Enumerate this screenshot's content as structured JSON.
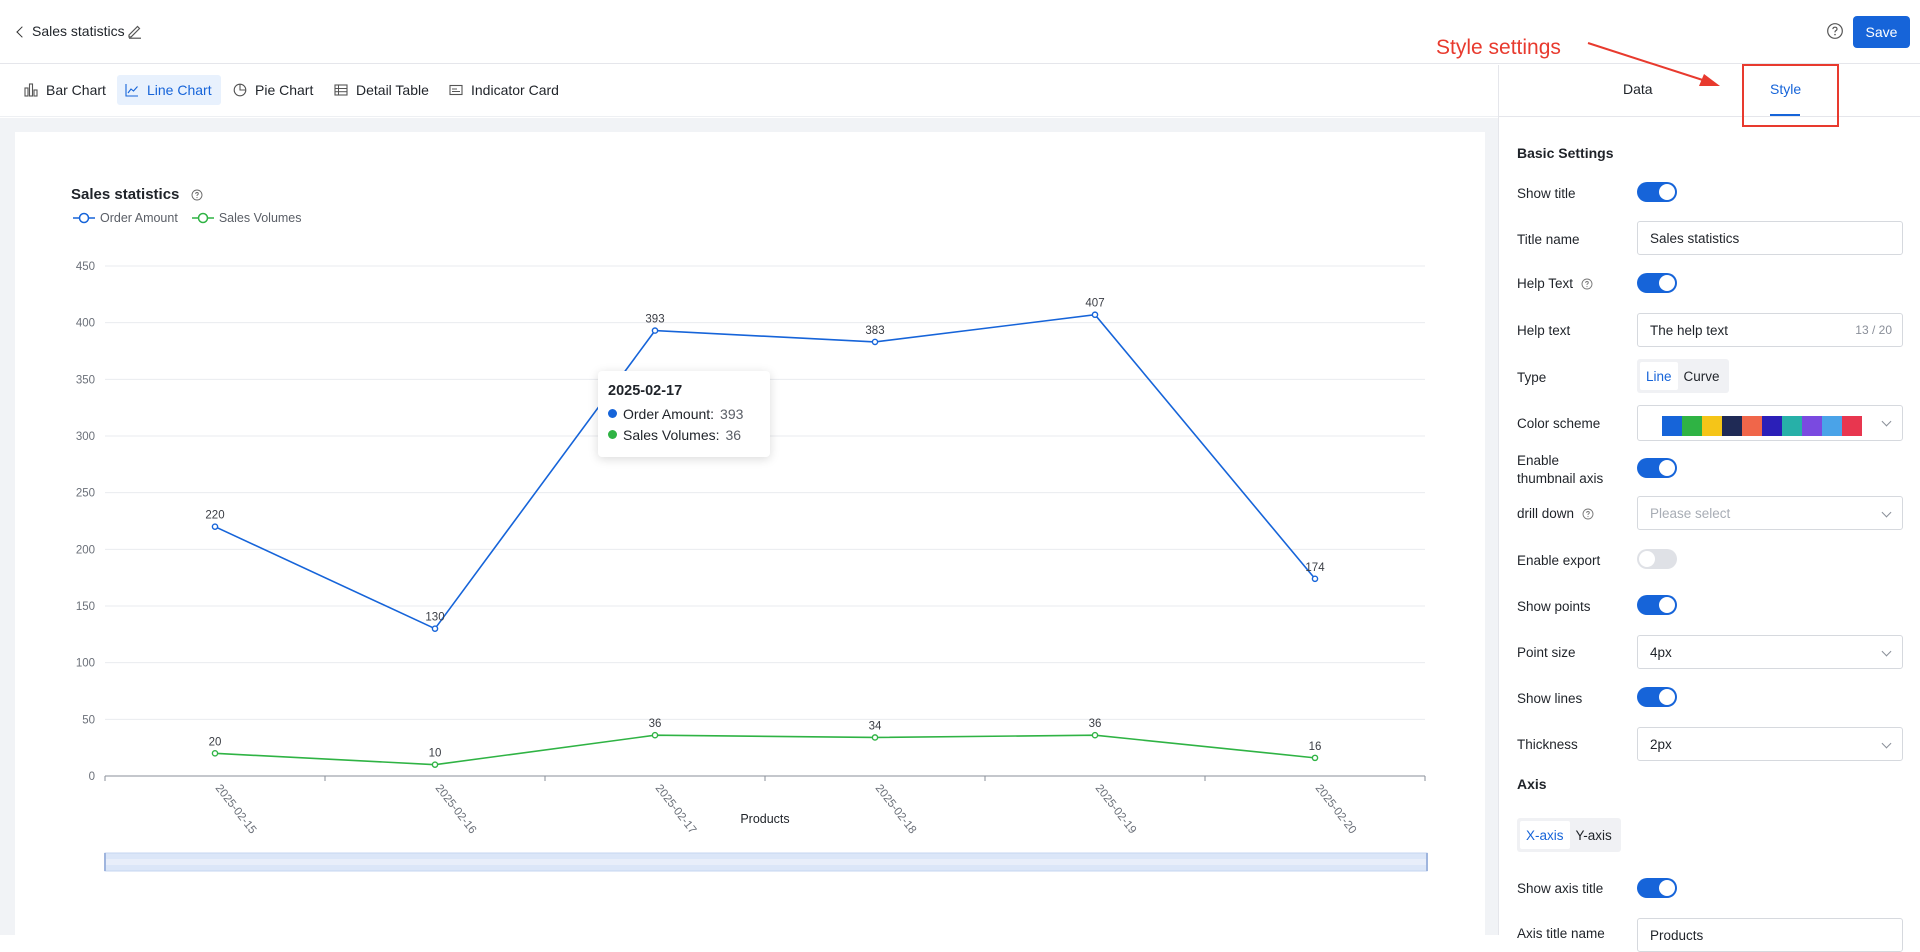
{
  "header": {
    "page_title": "Sales statistics",
    "save_label": "Save"
  },
  "chart_types": [
    {
      "label": "Bar Chart",
      "icon": "bar-chart-icon"
    },
    {
      "label": "Line Chart",
      "icon": "line-chart-icon",
      "active": true
    },
    {
      "label": "Pie Chart",
      "icon": "pie-chart-icon"
    },
    {
      "label": "Detail Table",
      "icon": "table-icon"
    },
    {
      "label": "Indicator Card",
      "icon": "card-icon"
    }
  ],
  "panel": {
    "tabs": [
      {
        "label": "Data"
      },
      {
        "label": "Style",
        "active": true
      }
    ],
    "basic_settings_title": "Basic Settings",
    "show_title_label": "Show title",
    "show_title": true,
    "title_name_label": "Title name",
    "title_name_value": "Sales statistics",
    "help_text_toggle_label": "Help Text",
    "help_text_enabled": true,
    "help_text_label": "Help text",
    "help_text_value": "The help text",
    "help_text_counter": "13 / 20",
    "type_label": "Type",
    "type_options": [
      "Line",
      "Curve"
    ],
    "type_selected": "Line",
    "color_scheme_label": "Color scheme",
    "color_scheme": [
      "#1664d9",
      "#2fb344",
      "#f5c518",
      "#1f2a55",
      "#f0664a",
      "#2b1fb8",
      "#27b0a8",
      "#7a4ae0",
      "#4aa3e8",
      "#e8364f"
    ],
    "thumbnail_label_line1": "Enable",
    "thumbnail_label_line2": "thumbnail axis",
    "thumbnail_enabled": true,
    "drill_down_label": "drill down",
    "drill_down_placeholder": "Please select",
    "enable_export_label": "Enable export",
    "enable_export": false,
    "show_points_label": "Show points",
    "show_points": true,
    "point_size_label": "Point size",
    "point_size_value": "4px",
    "show_lines_label": "Show lines",
    "show_lines": true,
    "thickness_label": "Thickness",
    "thickness_value": "2px",
    "axis_title": "Axis",
    "axis_options": [
      "X-axis",
      "Y-axis"
    ],
    "axis_selected": "X-axis",
    "show_axis_title_label": "Show axis title",
    "show_axis_title": true,
    "axis_title_name_label": "Axis title name",
    "axis_title_name_value": "Products"
  },
  "annotation": {
    "text": "Style settings",
    "color": "#e83a2e"
  },
  "tooltip": {
    "date": "2025-02-17",
    "rows": [
      {
        "label": "Order Amount:",
        "value": "393",
        "color": "#1664d9"
      },
      {
        "label": "Sales Volumes:",
        "value": "36",
        "color": "#2fb344"
      }
    ]
  },
  "chart_data": {
    "type": "line",
    "title": "Sales statistics",
    "xlabel": "Products",
    "ylabel": "",
    "categories": [
      "2025-02-15",
      "2025-02-16",
      "2025-02-17",
      "2025-02-18",
      "2025-02-19",
      "2025-02-20"
    ],
    "series": [
      {
        "name": "Order Amount",
        "color": "#1664d9",
        "values": [
          220,
          130,
          393,
          383,
          407,
          174
        ]
      },
      {
        "name": "Sales Volumes",
        "color": "#2fb344",
        "values": [
          20,
          10,
          36,
          34,
          36,
          16
        ]
      }
    ],
    "y_ticks": [
      0,
      50,
      100,
      150,
      200,
      250,
      300,
      350,
      400,
      450
    ],
    "ylim": [
      0,
      450
    ],
    "grid": true,
    "legend": "top-left",
    "data_labels": true
  }
}
